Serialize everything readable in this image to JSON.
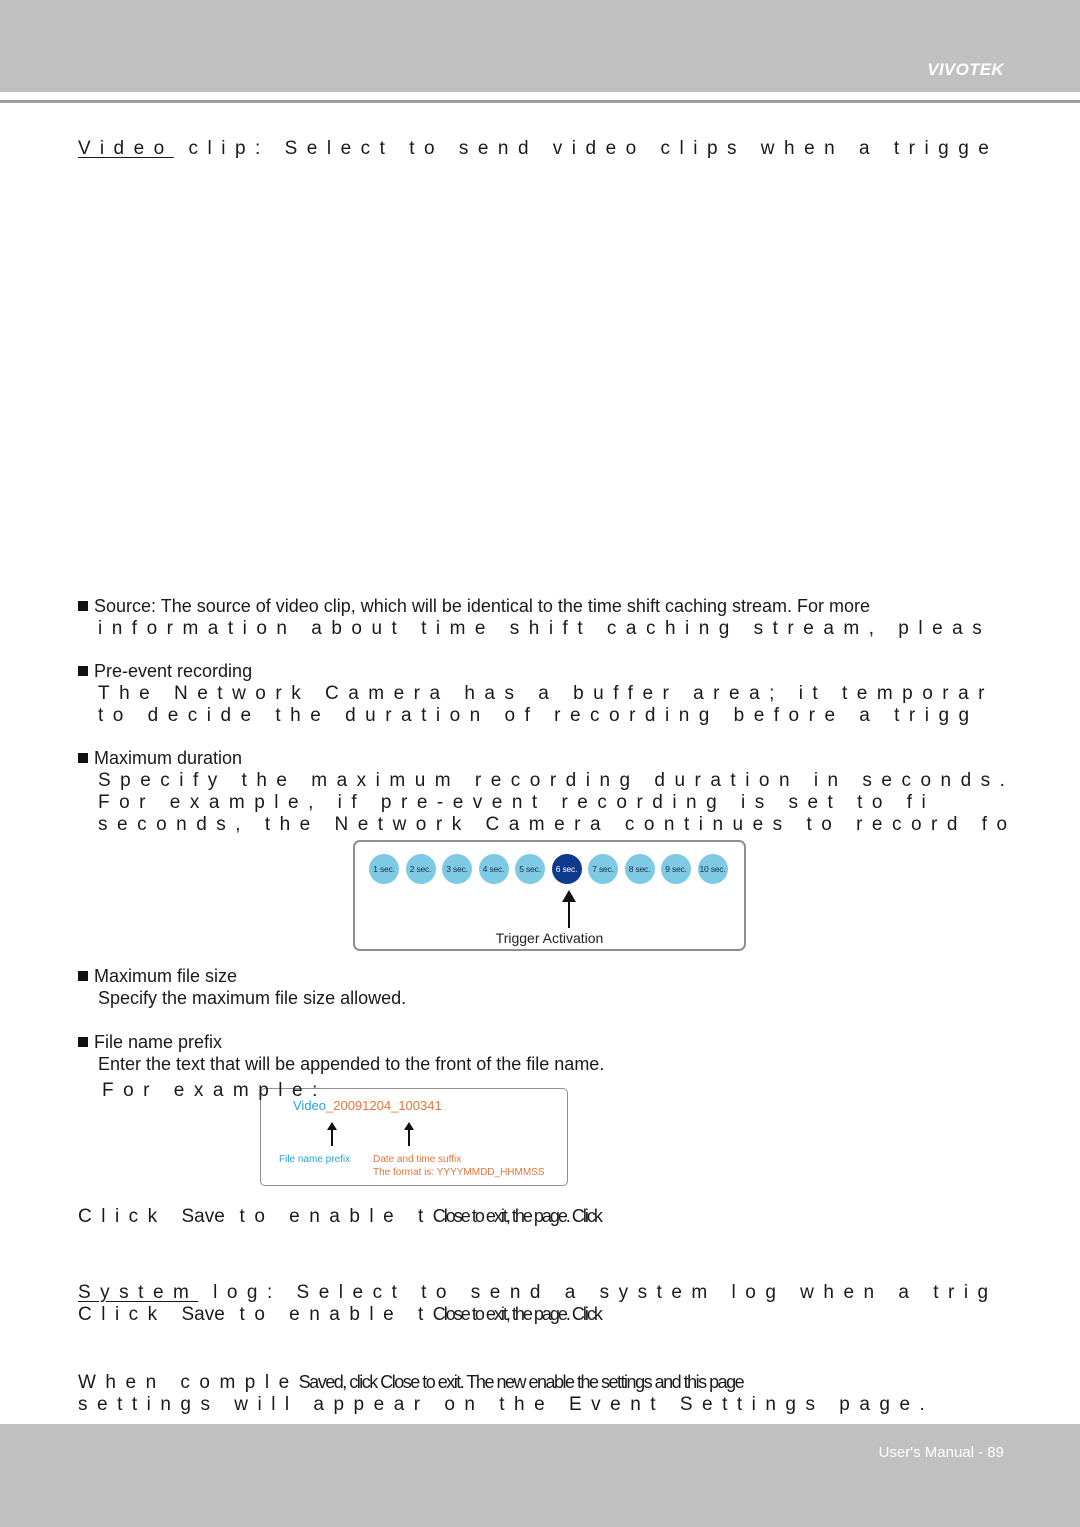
{
  "header": {
    "brand": "VIVOTEK"
  },
  "video_clip": {
    "label": "Video",
    "rest": " clip: Select to send video clips when a trigge"
  },
  "bullets": {
    "source": {
      "title": "Source: The source of video clip, which will be identical to the time shift caching stream. For more",
      "line1": "information about time shift caching stream, pleas"
    },
    "pre_event": {
      "title": "Pre-event recording",
      "line1": "The Network Camera has a buffer area; it temporar",
      "line2": "to decide the duration of recording before a trigg"
    },
    "max_duration": {
      "title": "Maximum duration",
      "line1": "Specify the maximum recording duration in seconds.",
      "line2": "For example, if pre-event recording is set to fi",
      "line3": "seconds, the Network Camera continues to record fo"
    },
    "max_file_size": {
      "title": "Maximum file size",
      "line1": "Specify the maximum file size allowed."
    },
    "file_name_prefix": {
      "title": "File name prefix",
      "line1": "Enter the text that will be appended to the front of the file name.",
      "line2": "For example:"
    }
  },
  "duration_diagram": {
    "seconds": [
      "1 sec.",
      "2 sec.",
      "3 sec.",
      "4 sec.",
      "5 sec.",
      "6 sec.",
      "7 sec.",
      "8 sec.",
      "9 sec.",
      "10 sec."
    ],
    "active_index": 5,
    "trigger_label": "Trigger Activation",
    "colors": {
      "inactive": "#7ecae4",
      "active": "#0d3a8f"
    }
  },
  "filename_diagram": {
    "prefix": "Video",
    "suffix": "_20091204_100341",
    "prefix_label": "File name prefix",
    "suffix_label": "Date and time suffix",
    "format_label": "The format is: YYYYMMDD_HHMMSS",
    "colors": {
      "prefix": "#2aa3dc",
      "suffix": "#e8743b"
    }
  },
  "save_line_1": {
    "a": "Click ",
    "save": "Save",
    "b": " to enable t",
    "overlap": "Close to exit, the page. Click"
  },
  "system_log": {
    "label": "System",
    "rest": " log: Select to send a system log when a trig"
  },
  "save_line_2": {
    "a": "Click ",
    "save": "Save",
    "b": " to enable t",
    "overlap": "Close to exit, the page. Click"
  },
  "completion": {
    "line1_a": "When comple",
    "line1_overlap": "Saved, click Close to exit. The new enable the settings and this page",
    "line2": "settings will appear on the Event Settings page."
  },
  "footer": {
    "page_label": "User's Manual - 89"
  }
}
